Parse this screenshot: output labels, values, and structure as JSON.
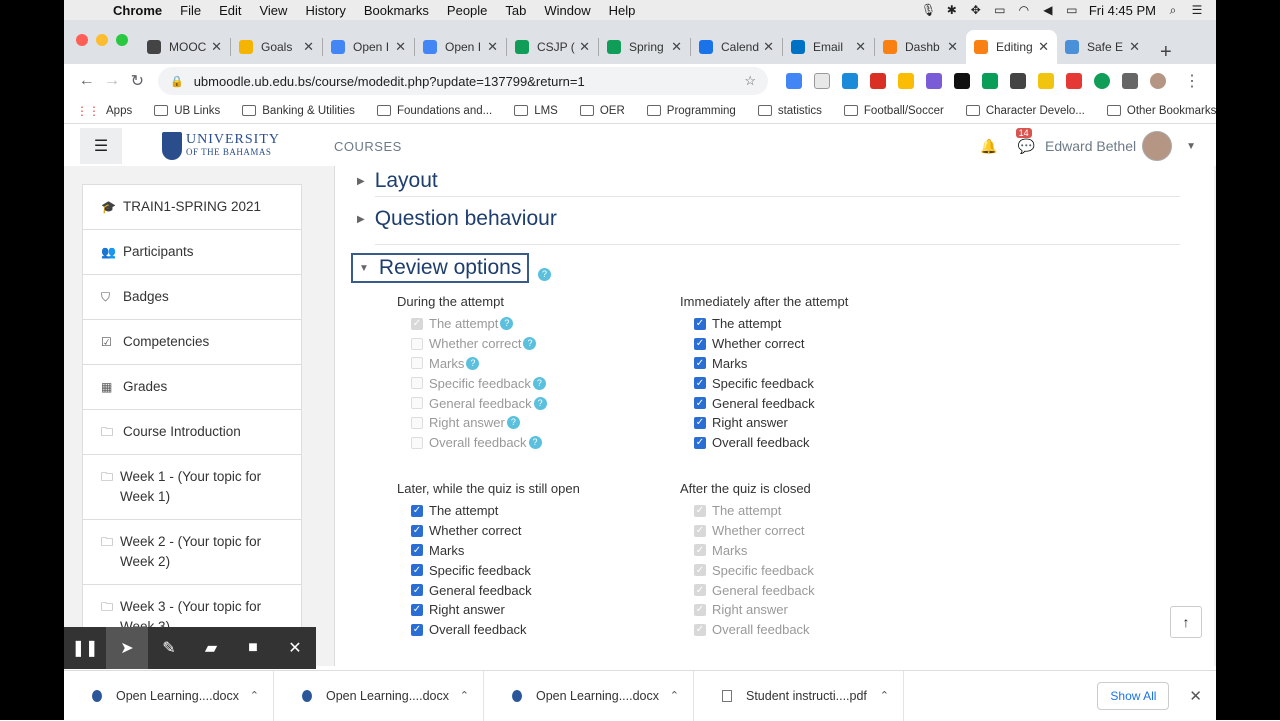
{
  "menubar": {
    "items": [
      "Chrome",
      "File",
      "Edit",
      "View",
      "History",
      "Bookmarks",
      "People",
      "Tab",
      "Window",
      "Help"
    ],
    "clock": "Fri 4:45 PM"
  },
  "tabs": [
    {
      "title": "MOOC",
      "color": "#444"
    },
    {
      "title": "Goals",
      "color": "#f4b400"
    },
    {
      "title": "Open I",
      "color": "#4285f4"
    },
    {
      "title": "Open I",
      "color": "#4285f4"
    },
    {
      "title": "CSJP (",
      "color": "#0f9d58"
    },
    {
      "title": "Spring",
      "color": "#0f9d58"
    },
    {
      "title": "Calend",
      "color": "#1a73e8"
    },
    {
      "title": "Email",
      "color": "#0072c6"
    },
    {
      "title": "Dashb",
      "color": "#f98012"
    },
    {
      "title": "Editing",
      "color": "#f98012"
    },
    {
      "title": "Safe E",
      "color": "#4a90d9"
    }
  ],
  "address": {
    "url": "ubmoodle.ub.edu.bs/course/modedit.php?update=137799&return=1"
  },
  "bookmarks": [
    "Apps",
    "UB Links",
    "Banking & Utilities",
    "Foundations and...",
    "LMS",
    "OER",
    "Programming",
    "statistics",
    "Football/Soccer",
    "Character Develo...",
    "Other Bookmarks"
  ],
  "moodle": {
    "logo_line1": "UNIVERSITY",
    "logo_line2": "OF THE BAHAMAS",
    "courses": "COURSES",
    "messages_count": "14",
    "user_name": "Edward Bethel"
  },
  "sidebar": [
    {
      "icon": "graduation-cap-icon",
      "label": "TRAIN1-SPRING 2021"
    },
    {
      "icon": "users-icon",
      "label": "Participants"
    },
    {
      "icon": "shield-icon",
      "label": "Badges"
    },
    {
      "icon": "checkbox-icon",
      "label": "Competencies"
    },
    {
      "icon": "table-icon",
      "label": "Grades"
    },
    {
      "icon": "folder-icon",
      "label": "Course Introduction"
    },
    {
      "icon": "folder-icon",
      "label": "Week 1 - (Your topic for Week 1)"
    },
    {
      "icon": "folder-icon",
      "label": "Week 2 - (Your topic for Week 2)"
    },
    {
      "icon": "folder-icon",
      "label": "Week 3 - (Your topic for Week 3)"
    }
  ],
  "sections": {
    "layout": "Layout",
    "question_behaviour": "Question behaviour",
    "review_options": "Review options"
  },
  "review": {
    "during": {
      "title": "During the attempt",
      "items": [
        "The attempt",
        "Whether correct",
        "Marks",
        "Specific feedback",
        "General feedback",
        "Right answer",
        "Overall feedback"
      ]
    },
    "immediately": {
      "title": "Immediately after the attempt",
      "items": [
        "The attempt",
        "Whether correct",
        "Marks",
        "Specific feedback",
        "General feedback",
        "Right answer",
        "Overall feedback"
      ]
    },
    "later": {
      "title": "Later, while the quiz is still open",
      "items": [
        "The attempt",
        "Whether correct",
        "Marks",
        "Specific feedback",
        "General feedback",
        "Right answer",
        "Overall feedback"
      ]
    },
    "after": {
      "title": "After the quiz is closed",
      "items": [
        "The attempt",
        "Whether correct",
        "Marks",
        "Specific feedback",
        "General feedback",
        "Right answer",
        "Overall feedback"
      ]
    }
  },
  "downloads": [
    {
      "name": "Open Learning....docx"
    },
    {
      "name": "Open Learning....docx"
    },
    {
      "name": "Open Learning....docx"
    },
    {
      "name": "Student instructi....pdf"
    }
  ],
  "download_bar": {
    "show_all": "Show All"
  }
}
